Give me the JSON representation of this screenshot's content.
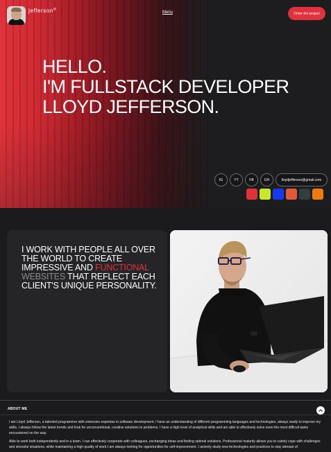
{
  "header": {
    "brand_name": "jefferson",
    "brand_mark": "®",
    "menu_label": "Menu",
    "cta_label": "Order the project"
  },
  "hero": {
    "line1": "HELLO.",
    "line2": "I'M FULLSTACK DEVELOPER",
    "line3": "LLOYD JEFFERSON."
  },
  "social": {
    "ig": "IG",
    "yt": "YT",
    "fb": "FB",
    "gh": "GH",
    "email": "lloydjefferson@gmail.com"
  },
  "swatches": [
    "#e0323a",
    "#c8e62a",
    "#1739f2",
    "#e05a3a",
    "#2f3f3d",
    "#f07a12"
  ],
  "statement": {
    "part1": "I WORK WITH PEOPLE ALL OVER THE WORLD TO CREATE IMPRESSIVE AND ",
    "highlight_red": "FUNCTIONAL",
    "highlight_grey": "WEBSITES",
    "part2": " THAT REFLECT EACH CLIENT'S UNIQUE PERSONALITY."
  },
  "about": {
    "title": "ABOUT ME",
    "p1": "I am Lloyd Jefferson, a talented programmer with extensive expertise in software development. I have an understanding of different programming languages and technologies, always ready to improve my skills. I always follow the latest trends and look for unconventional, creative solutions to problems. I have a high level of analytical skills and am able to effectively solve even the most difficult tasks encountered on the way.",
    "p2": "Able to work both independently and in a team. I can effectively cooperate with colleagues, exchanging ideas and finding optimal solutions. Professional maturity allows you to calmly cope with challenges and stressful situations, while maintaining a high quality of work.I am always looking for opportunities for self-improvement. I actively study new technologies and practices to stay abreast of"
  },
  "icons": {
    "chevron": "chevron-up-icon"
  }
}
